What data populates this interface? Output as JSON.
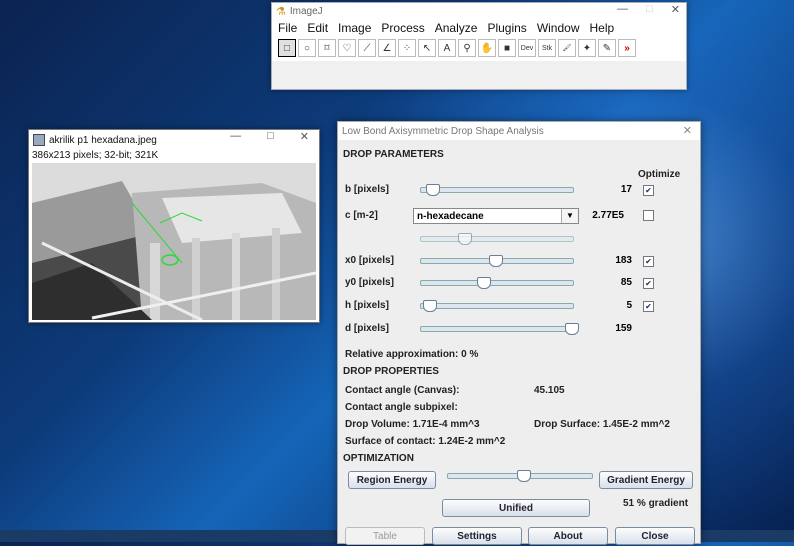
{
  "imagej": {
    "title": "ImageJ",
    "menu": [
      "File",
      "Edit",
      "Image",
      "Process",
      "Analyze",
      "Plugins",
      "Window",
      "Help"
    ],
    "tools": [
      {
        "icon": "rectangle-tool-icon",
        "glyph": "□"
      },
      {
        "icon": "oval-tool-icon",
        "glyph": "○"
      },
      {
        "icon": "polygon-tool-icon",
        "glyph": "⌑"
      },
      {
        "icon": "freehand-tool-icon",
        "glyph": "♡"
      },
      {
        "icon": "line-tool-icon",
        "glyph": "⟋"
      },
      {
        "icon": "angle-tool-icon",
        "glyph": "∠"
      },
      {
        "icon": "point-tool-icon",
        "glyph": "⁘"
      },
      {
        "icon": "wand-tool-icon",
        "glyph": "↖"
      },
      {
        "icon": "text-tool-icon",
        "glyph": "A"
      },
      {
        "icon": "magnifier-tool-icon",
        "glyph": "⚲"
      },
      {
        "icon": "hand-tool-icon",
        "glyph": "✋"
      },
      {
        "icon": "color-picker-icon",
        "glyph": "■"
      },
      {
        "icon": "dev-menu-icon",
        "glyph": "Dev"
      },
      {
        "icon": "stk-menu-icon",
        "glyph": "Stk"
      },
      {
        "icon": "brush-tool-icon",
        "glyph": "🖌"
      },
      {
        "icon": "flood-fill-icon",
        "glyph": "✦"
      },
      {
        "icon": "pencil-tool-icon",
        "glyph": "✎"
      },
      {
        "icon": "more-tools-icon",
        "glyph": "»"
      }
    ]
  },
  "image_window": {
    "title": "akrilik p1 hexadana.jpeg",
    "info": "386x213 pixels; 32-bit; 321K"
  },
  "dialog": {
    "title": "Low Bond Axisymmetric Drop Shape Analysis",
    "drop_parameters": "DROP PARAMETERS",
    "optimize": "Optimize",
    "params": [
      {
        "label": "b [pixels]",
        "value": "17",
        "checked": true,
        "pos": 0.04
      },
      {
        "label": "x0 [pixels]",
        "value": "183",
        "checked": true,
        "pos": 0.47
      },
      {
        "label": "y0 [pixels]",
        "value": "85",
        "checked": true,
        "pos": 0.39
      },
      {
        "label": "h [pixels]",
        "value": "5",
        "checked": true,
        "pos": 0.02
      },
      {
        "label": "d [pixels]",
        "value": "159",
        "checked": false,
        "pos": 0.99
      }
    ],
    "c_label": "c [m-2]",
    "c_combo": "n-hexadecane",
    "c_value": "2.77E5",
    "c_checked": false,
    "relative_approx": "Relative approximation: 0 %",
    "drop_properties": "DROP PROPERTIES",
    "contact_angle_label": "Contact angle (Canvas):",
    "contact_angle_value": "45.105",
    "contact_angle_subpixel": "Contact angle subpixel:",
    "drop_volume": "Drop Volume: 1.71E-4 mm^3",
    "drop_surface": "Drop Surface: 1.45E-2 mm^2",
    "surface_contact": "Surface of contact: 1.24E-2 mm^2",
    "optimization": "OPTIMIZATION",
    "region_energy": "Region Energy",
    "gradient_energy": "Gradient Energy",
    "unified": "Unified",
    "gradient_pct": "51 % gradient",
    "gradient_slider": 0.51,
    "buttons": {
      "table": "Table",
      "settings": "Settings",
      "about": "About",
      "close": "Close"
    }
  }
}
